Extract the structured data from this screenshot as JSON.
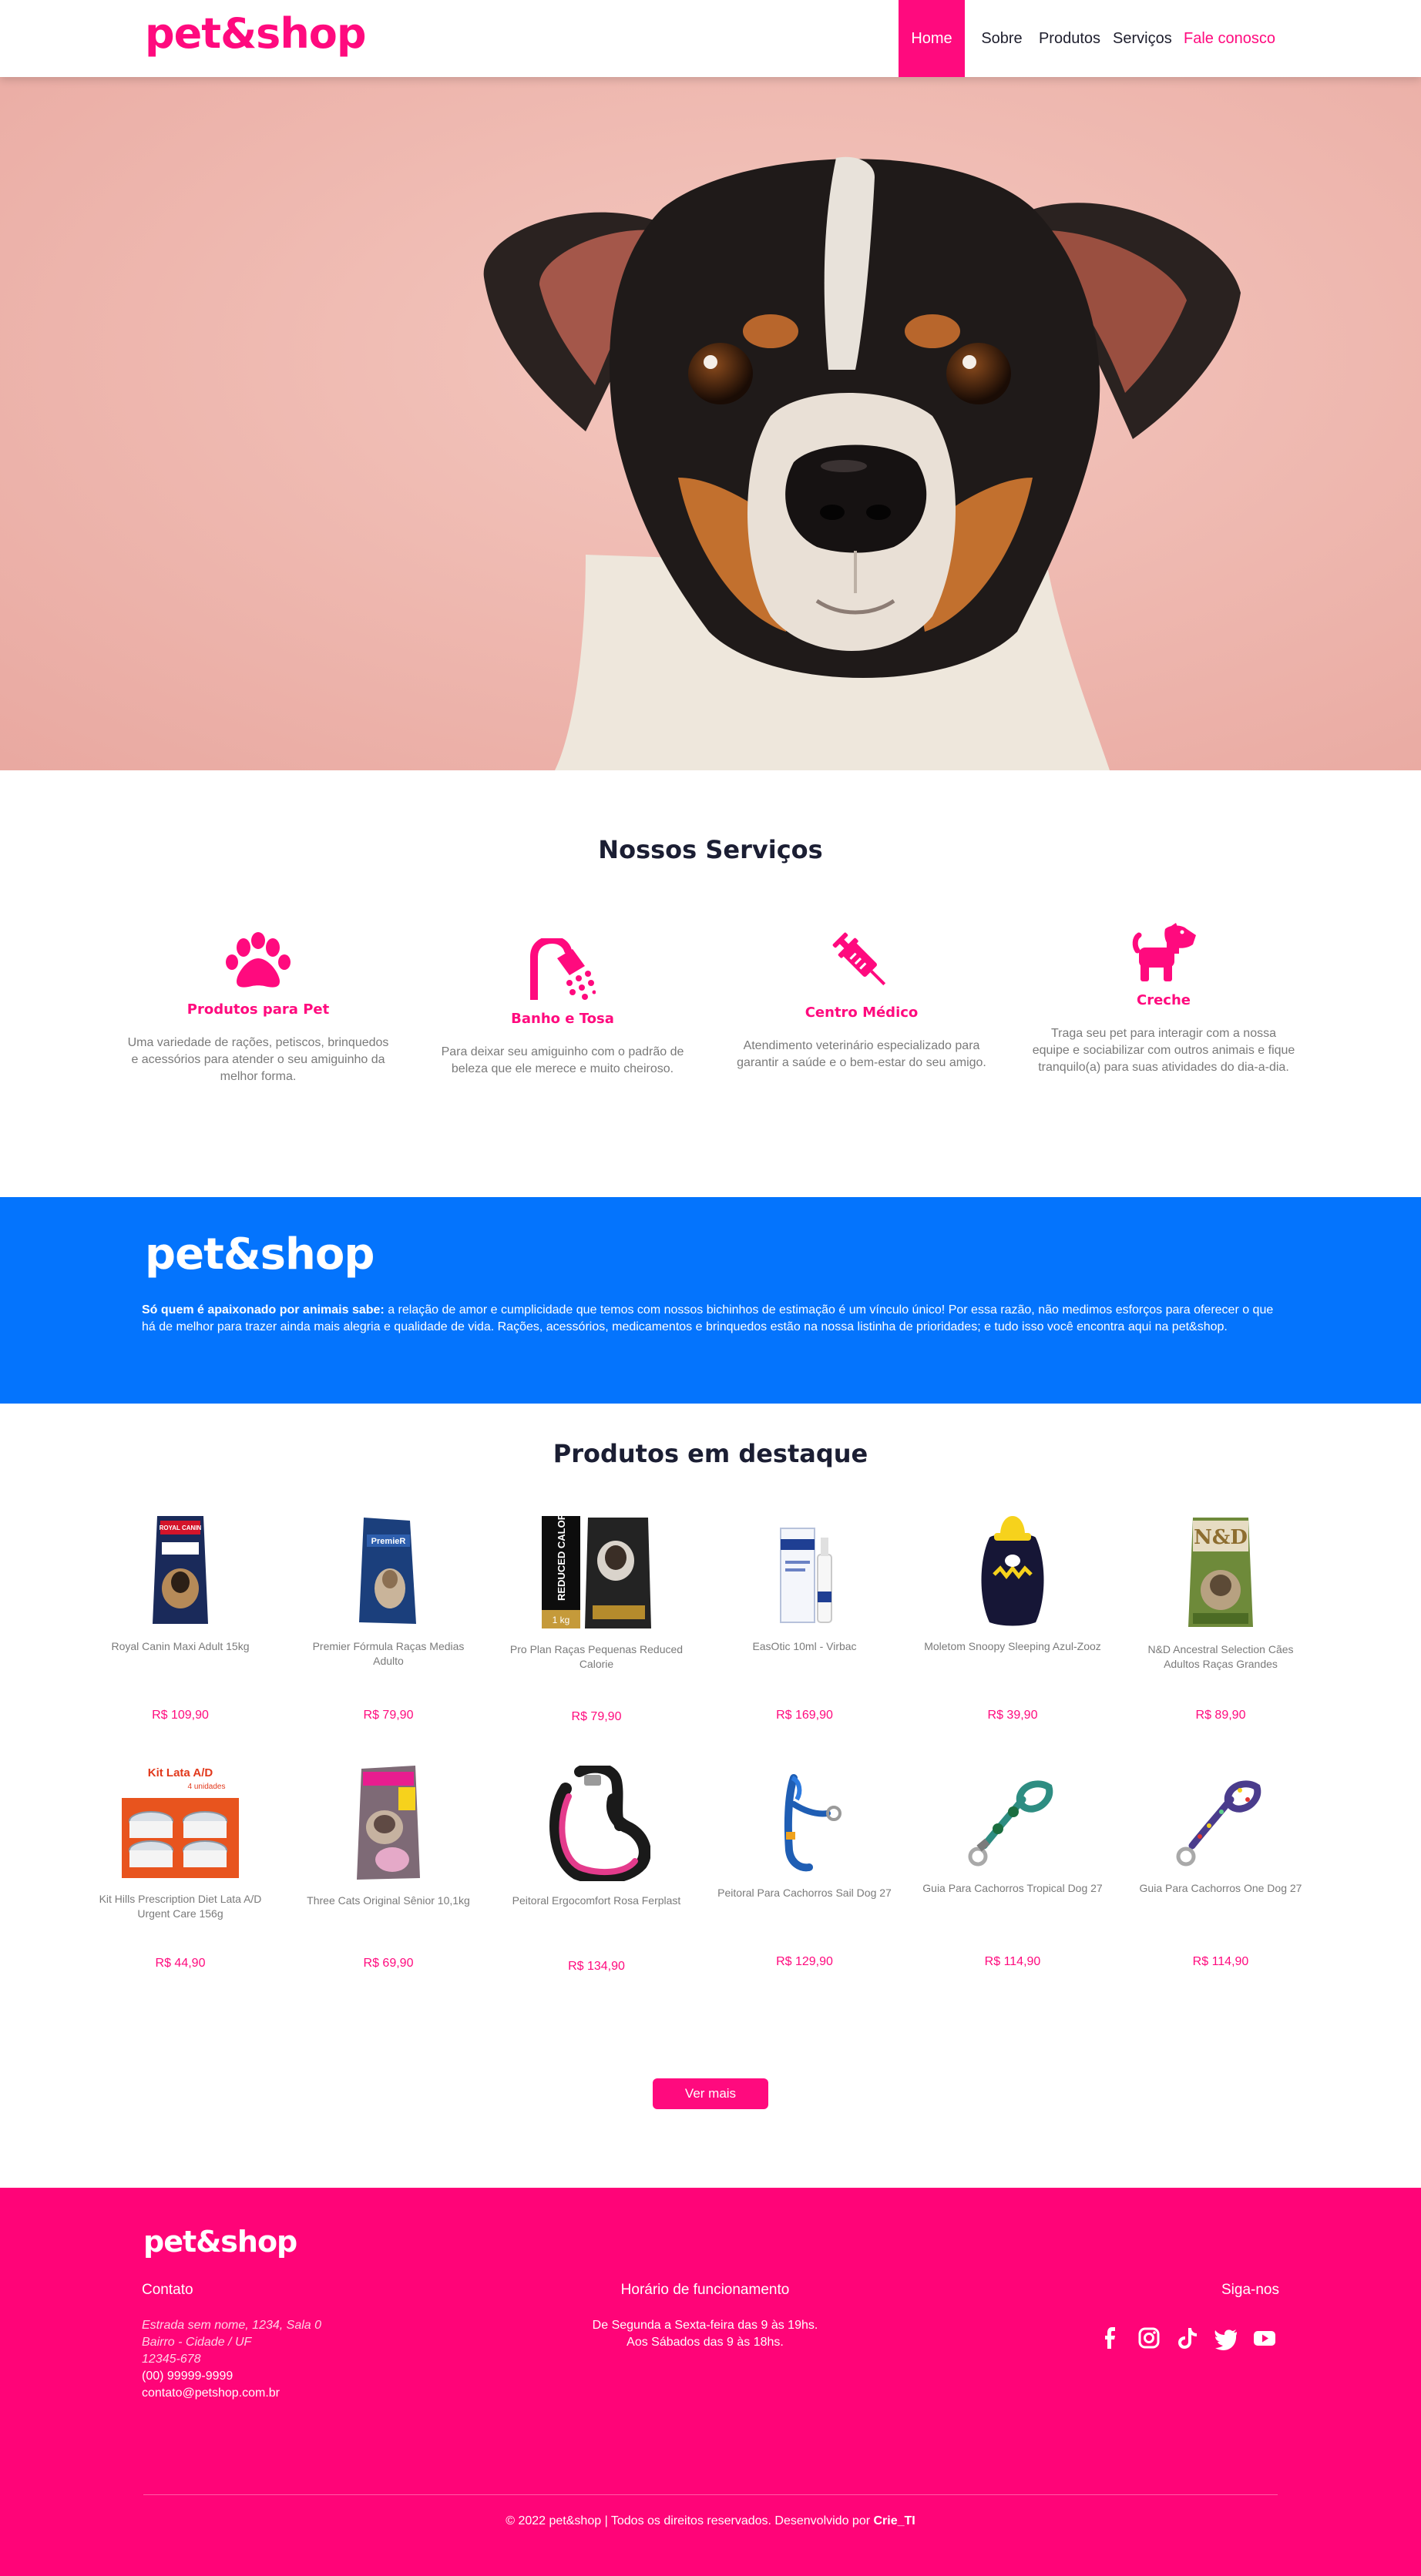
{
  "brand": {
    "logo": "pet&shop",
    "accent": "#ff0a7e",
    "blue": "#0474fd"
  },
  "nav": {
    "items": [
      {
        "label": "Home"
      },
      {
        "label": "Sobre"
      },
      {
        "label": "Produtos"
      },
      {
        "label": "Serviços"
      },
      {
        "label": "Fale conosco"
      }
    ]
  },
  "services": {
    "title": "Nossos Serviços",
    "items": [
      {
        "icon": "paw-icon",
        "name": "Produtos para Pet",
        "desc": "Uma variedade de rações, petiscos, brinquedos e acessórios para atender o seu amiguinho da melhor forma."
      },
      {
        "icon": "shower-icon",
        "name": "Banho e Tosa",
        "desc": "Para deixar seu amiguinho com o padrão de beleza que ele merece e muito cheiroso."
      },
      {
        "icon": "syringe-icon",
        "name": "Centro Médico",
        "desc": "Atendimento veterinário especializado para garantir a saúde e o bem-estar do seu amigo."
      },
      {
        "icon": "dog-icon",
        "name": "Creche",
        "desc": "Traga seu pet para interagir com a nossa equipe e sociabilizar com outros animais e fique tranquilo(a) para suas atividades do dia-a-dia."
      }
    ]
  },
  "about": {
    "logo": "pet&shop",
    "lead": "Só quem é apaixonado por animais sabe:",
    "text": " a relação de amor e cumplicidade que temos com nossos bichinhos de estimação é um vínculo único! Por essa razão, não medimos esforços para oferecer o que há de melhor para trazer ainda mais alegria e qualidade de vida. Rações, acessórios, medicamentos e brinquedos estão na nossa listinha de prioridades; e tudo isso você encontra aqui na pet&shop."
  },
  "products": {
    "title": "Produtos em destaque",
    "items": [
      {
        "name": "Royal Canin Maxi Adult 15kg",
        "price": "R$ 109,90"
      },
      {
        "name": "Premier Fórmula Raças Medias Adulto",
        "price": "R$ 79,90"
      },
      {
        "name": "Pro Plan Raças Pequenas Reduced Calorie",
        "price": "R$ 79,90"
      },
      {
        "name": "EasOtic 10ml - Virbac",
        "price": "R$ 169,90"
      },
      {
        "name": "Moletom Snoopy Sleeping Azul-Zooz",
        "price": "R$ 39,90"
      },
      {
        "name": "N&D Ancestral Selection Cães Adultos Raças Grandes",
        "price": "R$ 89,90"
      },
      {
        "name": "Kit Hills Prescription Diet Lata A/D Urgent Care 156g",
        "price": "R$ 44,90"
      },
      {
        "name": "Three Cats Original Sênior 10,1kg",
        "price": "R$ 69,90"
      },
      {
        "name": "Peitoral Ergocomfort Rosa Ferplast",
        "price": "R$ 134,90"
      },
      {
        "name": "Peitoral Para Cachorros Sail Dog 27",
        "price": "R$ 129,90"
      },
      {
        "name": "Guia Para Cachorros Tropical Dog 27",
        "price": "R$ 114,90"
      },
      {
        "name": "Guia Para Cachorros One Dog 27",
        "price": "R$ 114,90"
      }
    ],
    "packaging": {
      "royal_canin": "ROYAL CANIN",
      "premier": "PremieR",
      "proplan_side": "REDUCED CALORIE",
      "proplan_weight": "1 kg",
      "hills_title": "Kit Lata A/D",
      "hills_sub": "4 unidades",
      "nd": "N&D"
    },
    "more_label": "Ver mais"
  },
  "footer": {
    "logo": "pet&shop",
    "contact": {
      "title": "Contato",
      "address1": "Estrada sem nome, 1234, Sala 0",
      "address2": "Bairro - Cidade / UF",
      "zip": "12345-678",
      "phone": "(00) 99999-9999",
      "email": "contato@petshop.com.br"
    },
    "hours": {
      "title": "Horário de funcionamento",
      "line1": "De Segunda a Sexta-feira das 9 às 19hs.",
      "line2": "Aos Sábados das 9 às 18hs."
    },
    "social": {
      "title": "Siga-nos",
      "icons": [
        "facebook-icon",
        "instagram-icon",
        "tiktok-icon",
        "twitter-icon",
        "youtube-icon"
      ]
    },
    "copyright": "© 2022 pet&shop | Todos os direitos reservados. Desenvolvido por ",
    "developer": "Crie_TI"
  }
}
